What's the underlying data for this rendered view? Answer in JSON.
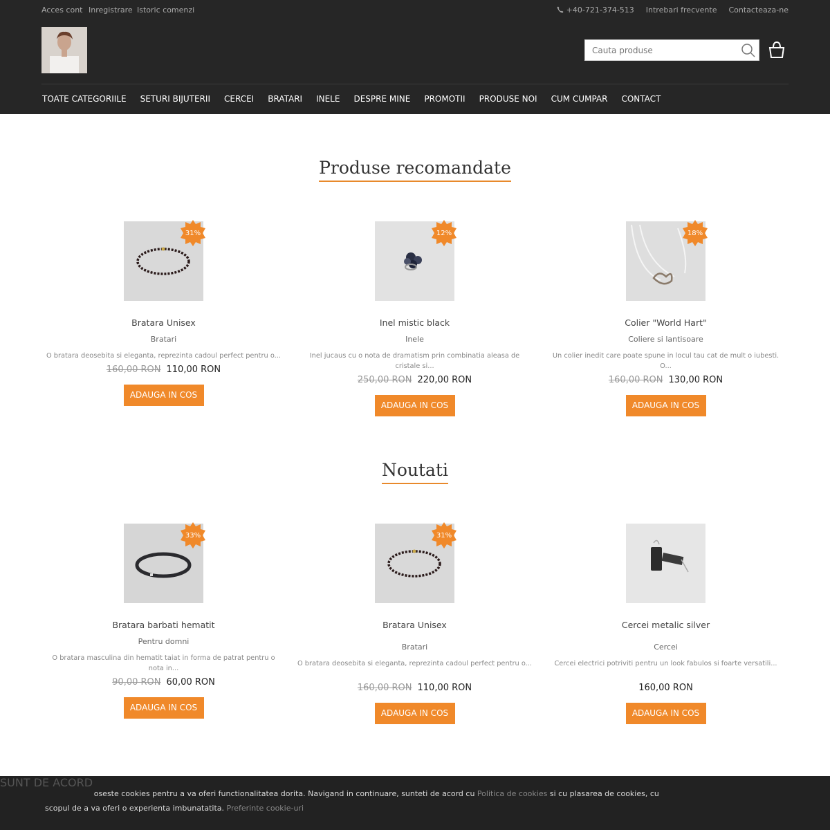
{
  "topbar": {
    "left": [
      "Acces cont",
      "Inregistrare",
      "Istoric comenzi"
    ],
    "phone": "+40-721-374-513",
    "faq": "Intrebari frecvente",
    "contact": "Contacteaza-ne"
  },
  "search": {
    "placeholder": "Cauta produse"
  },
  "nav": [
    "TOATE CATEGORIILE",
    "SETURI BIJUTERII",
    "CERCEI",
    "BRATARI",
    "INELE",
    "DESPRE MINE",
    "PROMOTII",
    "PRODUSE NOI",
    "CUM CUMPAR",
    "CONTACT"
  ],
  "recommended": {
    "title": "Produse recomandate",
    "products": [
      {
        "badge": "31%",
        "name": "Bratara Unisex",
        "category": "Bratari",
        "desc": "O bratara deosebita si eleganta, reprezinta cadoul perfect pentru o...",
        "old_price": "160,00 RON",
        "price": "110,00 RON",
        "button": "ADAUGA IN COS"
      },
      {
        "badge": "12%",
        "name": "Inel mistic black",
        "category": "Inele",
        "desc": "Inel jucaus cu o nota de dramatism prin combinatia aleasa de cristale si...",
        "old_price": "250,00 RON",
        "price": "220,00 RON",
        "button": "ADAUGA IN COS"
      },
      {
        "badge": "18%",
        "name": "Colier \"World Hart\"",
        "category": "Coliere si lantisoare",
        "desc": "Un colier inedit care poate spune in locul tau cat de mult o iubesti. O...",
        "old_price": "160,00 RON",
        "price": "130,00 RON",
        "button": "ADAUGA IN COS"
      }
    ]
  },
  "news": {
    "title": "Noutati",
    "products": [
      {
        "badge": "33%",
        "name": "Bratara barbati hematit",
        "category": "Pentru domni",
        "desc": "O bratara masculina din hematit taiat in forma de patrat pentru o nota in...",
        "old_price": "90,00 RON",
        "price": "60,00 RON",
        "button": "ADAUGA IN COS"
      },
      {
        "badge": "31%",
        "name": "Bratara Unisex",
        "category": "Bratari",
        "desc": "O bratara deosebita si eleganta, reprezinta cadoul perfect pentru o...",
        "old_price": "160,00 RON",
        "price": "110,00 RON",
        "button": "ADAUGA IN COS"
      },
      {
        "name": "Cercei metalic silver",
        "category": "Cercei",
        "desc": "Cercei electrici potriviti pentru un look fabulos si foarte versatili...",
        "price": "160,00 RON",
        "button": "ADAUGA IN COS"
      }
    ]
  },
  "cookie": {
    "text1": "Acest site foloseste cookies pentru a va oferi functionalitatea dorita. Navigand in continuare, sunteti de acord cu ",
    "policy_link": "Politica de cookies",
    "text2": " si cu plasarea de cookies, cu scopul de a va oferi o experienta imbunatatita. ",
    "prefs_link": "Preferinte cookie-uri",
    "accept": "SUNT DE ACORD"
  },
  "colors": {
    "accent": "#f0892a",
    "header_bg": "#262626"
  }
}
